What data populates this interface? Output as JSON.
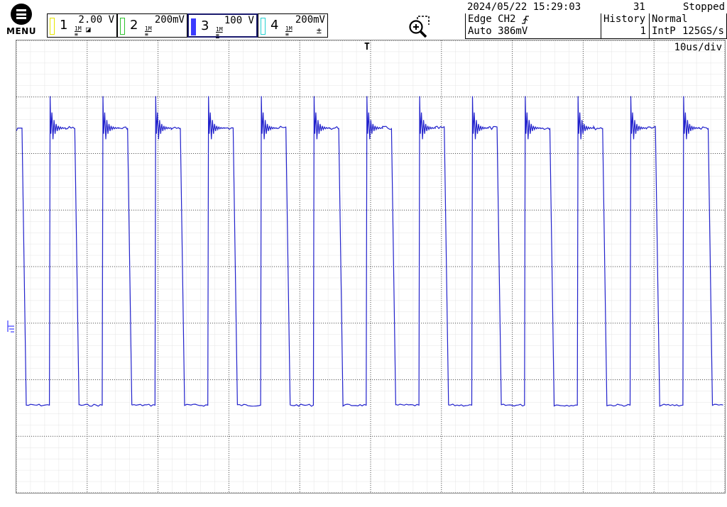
{
  "menu": {
    "label": "MENU"
  },
  "channels": [
    {
      "num": "1",
      "scale": "2.00 V",
      "color": "#e6e600",
      "selected": false
    },
    {
      "num": "2",
      "scale": "200mV",
      "color": "#2ec22e",
      "selected": false
    },
    {
      "num": "3",
      "scale": "100 V",
      "color": "#3b3bff",
      "selected": true
    },
    {
      "num": "4",
      "scale": "200mV",
      "color": "#27d1d1",
      "selected": false
    }
  ],
  "status": {
    "datetime": "2024/05/22 15:29:03",
    "count": "31",
    "state": "Stopped",
    "trigger_type": "Edge CH2",
    "trigger_mode": "Auto 386mV",
    "history_label": "History",
    "history_value": "1",
    "acq_mode": "Normal",
    "interp": "IntP",
    "sample_rate": "125GS/s"
  },
  "timebase": {
    "label": "10us/div"
  },
  "trigger_marker": "T",
  "waveform": {
    "channel": "3",
    "color": "#2222cc",
    "period_us": 7.45,
    "high_level_div": 2.45,
    "low_level_div": -2.45,
    "first_fall_us": 0.8
  },
  "grid": {
    "hdiv": 10,
    "vdiv": 8,
    "color": "#c9c9c9"
  }
}
